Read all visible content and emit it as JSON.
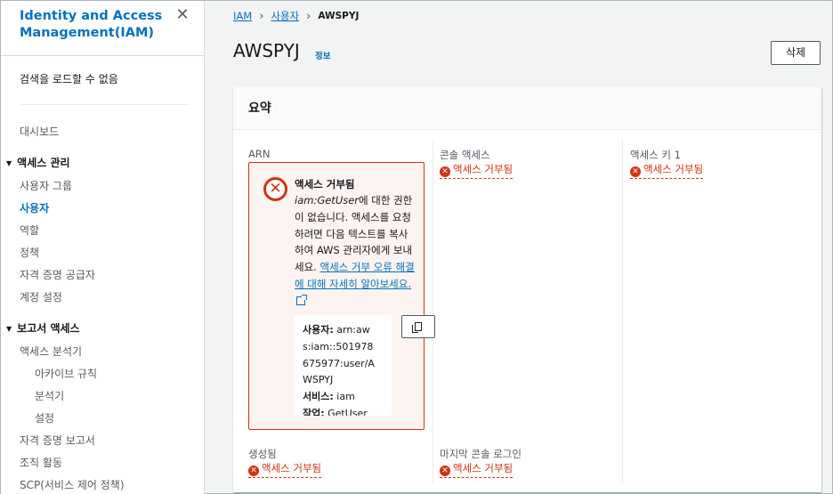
{
  "sidebar": {
    "title": "Identity and Access Management(IAM)",
    "search_error": "검색을 로드할 수 없음",
    "dashboard": "대시보드",
    "access_mgmt": {
      "label": "액세스 관리",
      "items": [
        "사용자 그룹",
        "사용자",
        "역할",
        "정책",
        "자격 증명 공급자",
        "계정 설정"
      ]
    },
    "access_reports": {
      "label": "보고서 액세스",
      "analyzer": "액세스 분석기",
      "analyzer_items": [
        "아카이브 규칙",
        "분석기",
        "설정"
      ],
      "items": [
        "자격 증명 보고서",
        "조직 활동",
        "SCP(서비스 제어 정책)"
      ]
    }
  },
  "breadcrumb": {
    "root": "IAM",
    "users": "사용자",
    "current": "AWSPYJ"
  },
  "page": {
    "title": "AWSPYJ",
    "info": "정보",
    "delete": "삭제"
  },
  "summary": {
    "title": "요약",
    "arn_label": "ARN",
    "console_access_label": "콘솔 액세스",
    "access_key_label": "액세스 키 1",
    "created_label": "생성됨",
    "last_login_label": "마지막 콘솔 로그인",
    "denied_text": "액세스 거부됨"
  },
  "popover": {
    "title": "액세스 거부됨",
    "action": "iam:GetUser",
    "body_1": "에 대한 권한이 없습니다. 액세스를 요청하려면 다음 텍스트를 복사하여 AWS 관리자에게 보내세요. ",
    "link": "액세스 거부 오류 해결에 대해 자세히 알아보세요.",
    "user_label": "사용자:",
    "user_value": "arn:aws:iam::501978675977:user/AWSPYJ",
    "service_label": "서비스:",
    "service_value": "iam",
    "action_label": "작업:",
    "action_value": "GetUser"
  },
  "colors": {
    "link": "#0073bb",
    "error": "#d13212"
  }
}
